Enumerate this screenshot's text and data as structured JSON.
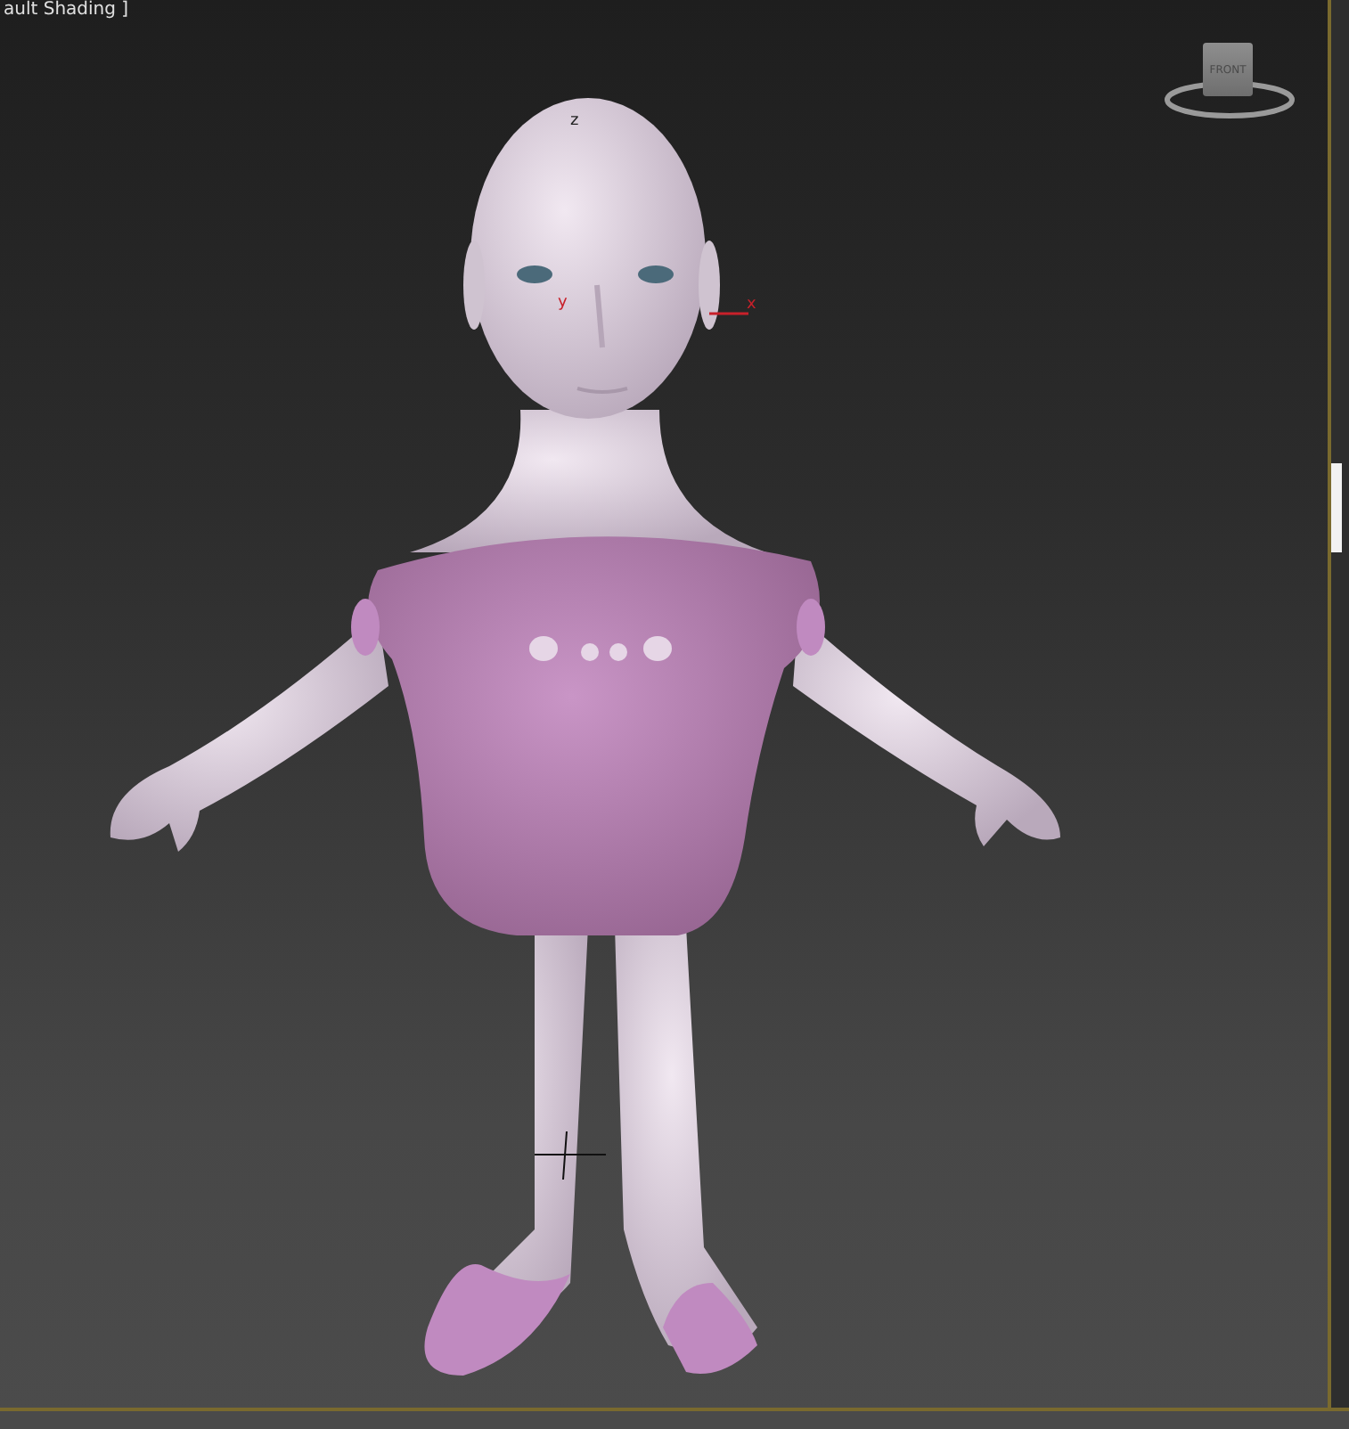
{
  "viewport": {
    "label": "ault Shading ]",
    "viewcube": {
      "face_label": "FRONT"
    },
    "gizmo_axes": [
      {
        "label": "z",
        "kind": "z"
      },
      {
        "label": "y",
        "kind": "y"
      },
      {
        "label": "x",
        "kind": "x"
      }
    ]
  }
}
